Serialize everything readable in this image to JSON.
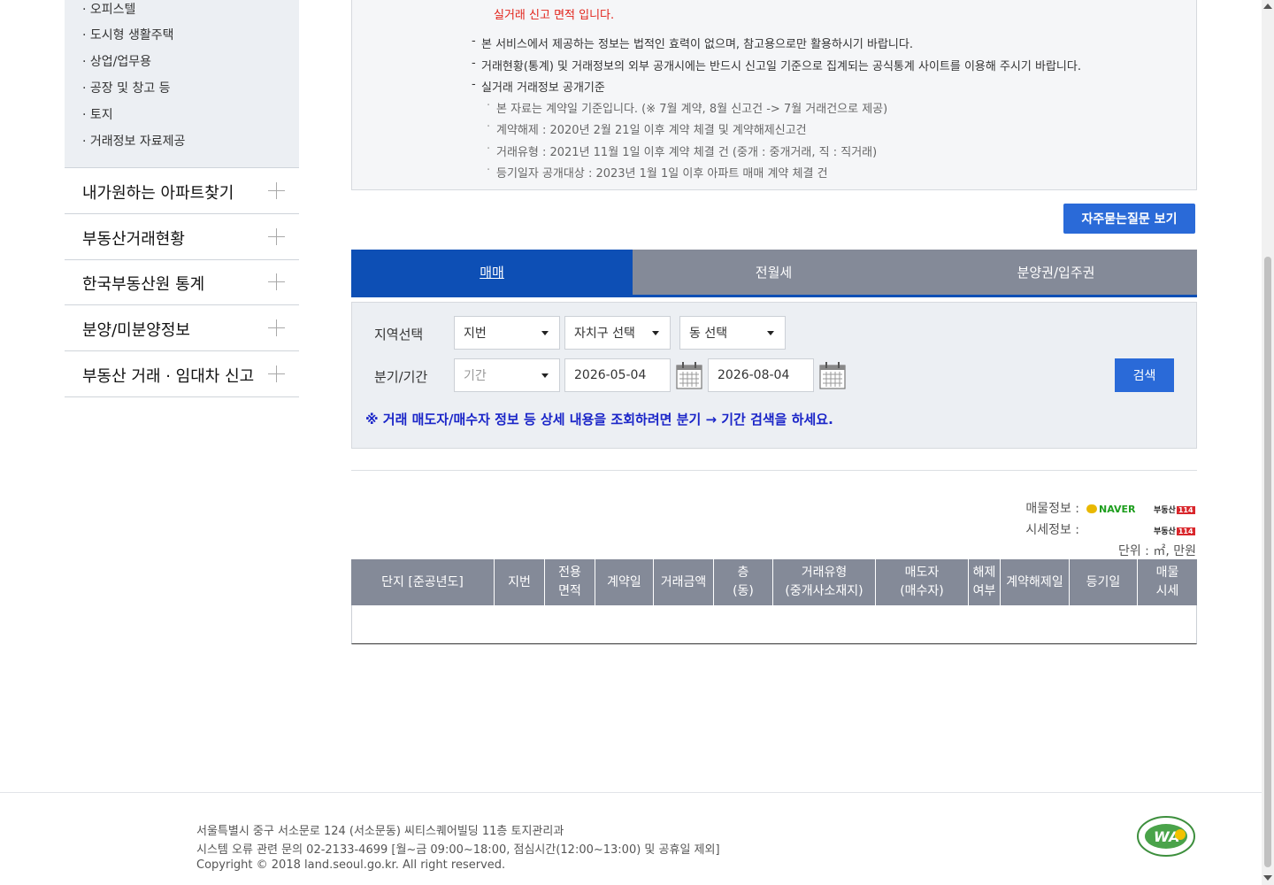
{
  "sidebar": {
    "sub_items": [
      "· 오피스텔",
      "· 도시형 생활주택",
      "· 상업/업무용",
      "· 공장 및 창고 등",
      "· 토지",
      "· 거래정보 자료제공"
    ],
    "menu": [
      {
        "label": "내가원하는 아파트찾기"
      },
      {
        "label": "부동산거래현황"
      },
      {
        "label": "한국부동산원 통계"
      },
      {
        "label": "분양/미분양정보"
      },
      {
        "label": "부동산 거래 · 임대차 신고"
      }
    ]
  },
  "info": {
    "red_text": "실거래 신고 면적 입니다.",
    "notices": [
      "본 서비스에서 제공하는 정보는 법적인 효력이 없으며, 참고용으로만 활용하시기 바랍니다.",
      "거래현황(통계) 및 거래정보의 외부 공개시에는 반드시 신고일 기준으로 집계되는 공식통계 사이트를 이용해 주시기 바랍니다.",
      "실거래 거래정보 공개기준"
    ],
    "sub_notices": [
      "본 자료는 계약일 기준입니다. (※ 7월 계약, 8월 신고건 -> 7월 거래건으로 제공)",
      "계약해제 : 2020년 2월 21일 이후 계약 체결 및 계약해제신고건",
      "거래유형 : 2021년 11월 1일 이후 계약 체결 건 (중개 : 중개거래, 직 : 직거래)",
      "등기일자 공개대상 : 2023년 1월 1일 이후 아파트 매매 계약 체결 건"
    ]
  },
  "faq_button": "자주묻는질문 보기",
  "tabs": [
    "매매",
    "전월세",
    "분양권/입주권"
  ],
  "search": {
    "region_label": "지역선택",
    "period_label": "분기/기간",
    "select_jibun": "지번",
    "select_gu": "자치구 선택",
    "select_dong": "동 선택",
    "select_period": "기간",
    "date_from": "2026-05-04",
    "date_to": "2026-08-04",
    "search_button": "검색",
    "hint": "※ 거래 매도자/매수자 정보 등 상세 내용을 조회하려면 분기 → 기간 검색을 하세요."
  },
  "source": {
    "listing_label": "매물정보 :",
    "price_label": "시세정보 :",
    "unit_label": "단위 : ㎡, 만원",
    "naver": "NAVER",
    "budongsan": "부동산",
    "budongsan_tag": "114"
  },
  "table": {
    "headers": [
      "단지 [준공년도]",
      "지번",
      "전용\n면적",
      "계약일",
      "거래금액",
      "층\n(동)",
      "거래유형\n(중개사소재지)",
      "매도자\n(매수자)",
      "해제\n여부",
      "계약해제일",
      "등기일",
      "매물\n시세"
    ]
  },
  "footer": {
    "address": "서울특별시 중구 서소문로 124 (서소문동) 씨티스퀘어빌딩 11층 토지관리과",
    "contact": "시스템 오류 관련 문의 02-2133-4699 [월~금 09:00~18:00, 점심시간(12:00~13:00) 및 공휴일 제외]",
    "copyright": "Copyright © 2018 land.seoul.go.kr. All right reserved.",
    "wa_mark": "WA"
  }
}
